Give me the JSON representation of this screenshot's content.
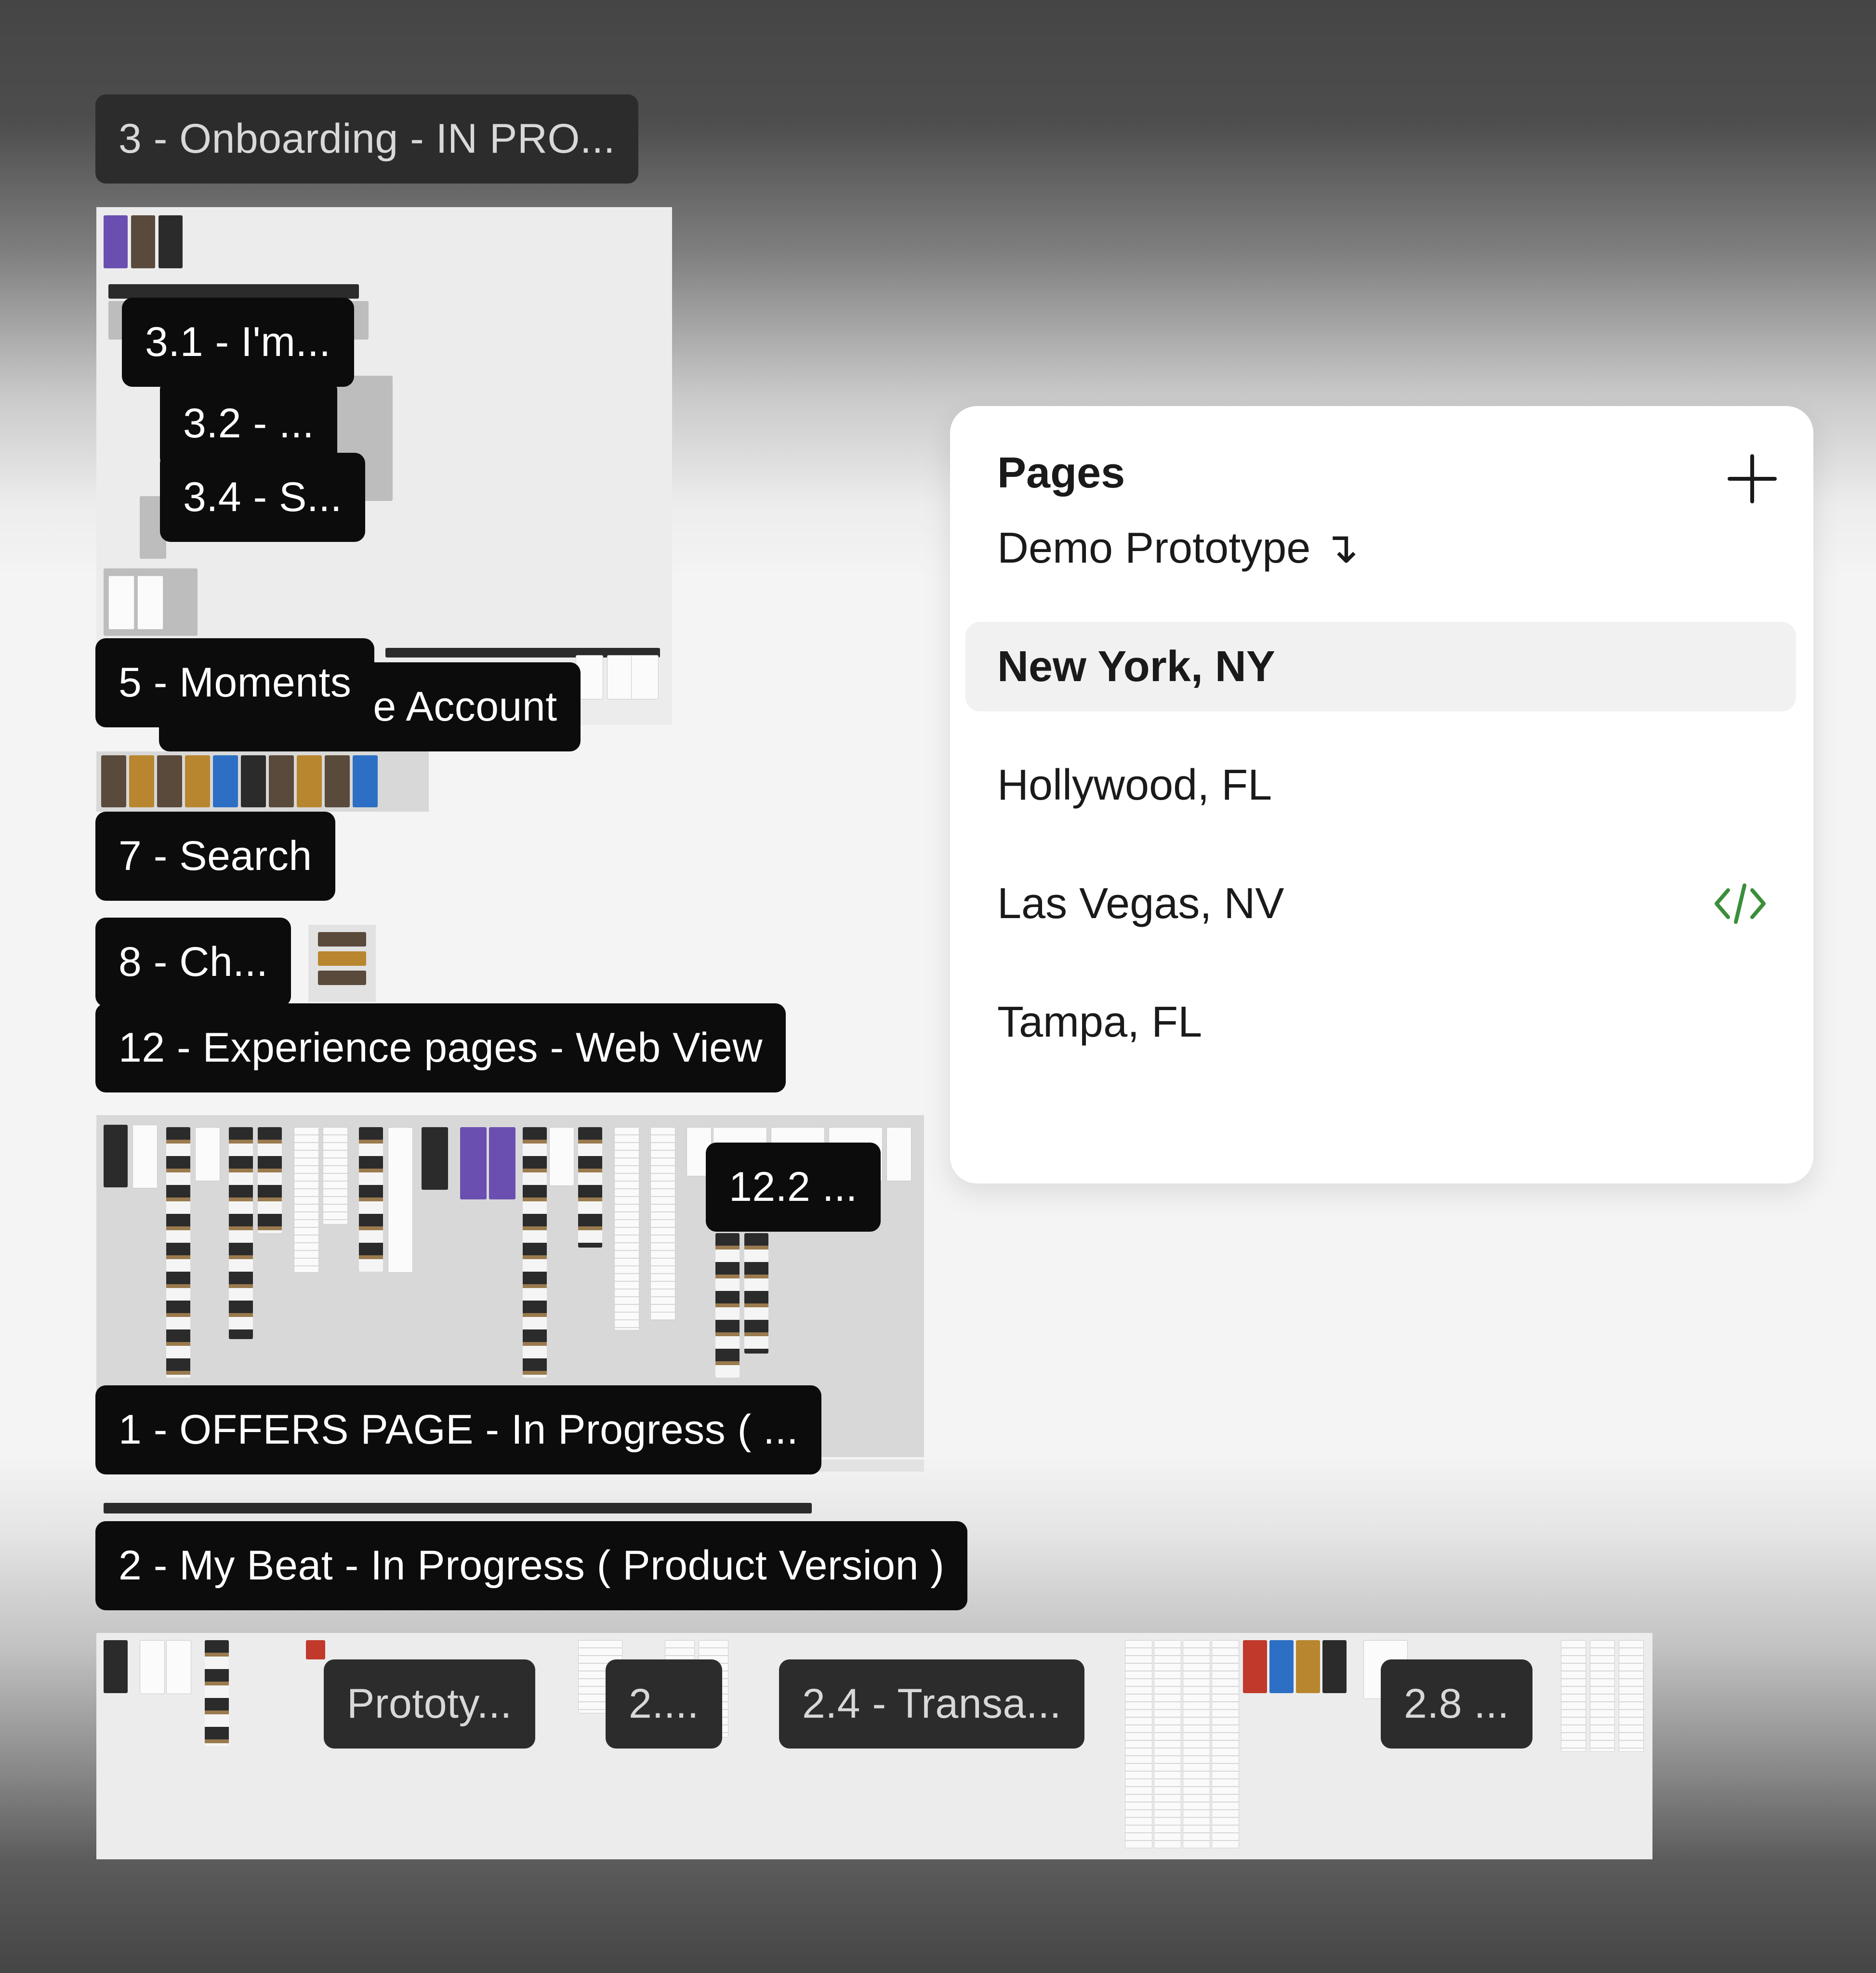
{
  "canvas": {
    "section_labels": {
      "onboarding": "3 - Onboarding - IN PRO...",
      "s3_1": "3.1 - I'm...",
      "s3_2": "3.2 - ...",
      "s3_4": "3.4 - S...",
      "create_account": "te Account",
      "moments": "5 - Moments",
      "search": "7 - Search",
      "checkout": "8 - Ch...",
      "experience": "12 - Experience pages - Web View",
      "s12_2": "12.2 ...",
      "offers": "1 - OFFERS PAGE - In Progress ( ...",
      "my_beat": "2 - My Beat - In Progress ( Product Version )",
      "prototype": "Prototy...",
      "s2_x": "2....",
      "transactions": "2.4 - Transa...",
      "s2_8": "2.8 ..."
    }
  },
  "pages_panel": {
    "title": "Pages",
    "add_icon": "plus-icon",
    "items": [
      {
        "label": "Demo Prototype ↴"
      },
      {
        "label": "New York, NY",
        "selected": true
      },
      {
        "label": "Hollywood, FL"
      },
      {
        "label": "Las Vegas, NV",
        "icon": "code-icon"
      },
      {
        "label": "Tampa, FL"
      }
    ]
  },
  "colors": {
    "label_bg": "#0c0c0c",
    "label_text": "#ffffff",
    "panel_bg": "#ffffff",
    "selected_bg": "#f1f1f1",
    "code_icon": "#3a8f3a",
    "canvas_bg": "#f4f4f4"
  }
}
